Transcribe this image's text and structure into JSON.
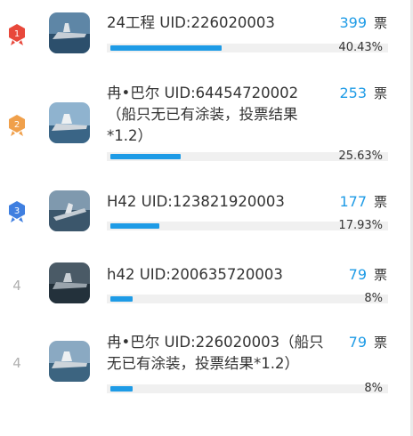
{
  "vote_list": [
    {
      "rank_label": "1",
      "name": "24工程 UID:226020003",
      "votes": "399",
      "unit": "票",
      "percent": "40.43%",
      "fraction": 0.4043
    },
    {
      "rank_label": "2",
      "name": "冉•巴尔 UID:64454720002\n（船只无已有涂装，投票结果\n*1.2）",
      "votes": "253",
      "unit": "票",
      "percent": "25.63%",
      "fraction": 0.2563
    },
    {
      "rank_label": "3",
      "name": "H42 UID:123821920003",
      "votes": "177",
      "unit": "票",
      "percent": "17.93%",
      "fraction": 0.1793
    },
    {
      "rank_label": "4",
      "name": "h42 UID:200635720003",
      "votes": "79",
      "unit": "票",
      "percent": "8%",
      "fraction": 0.08
    },
    {
      "rank_label": "4",
      "name": "冉•巴尔 UID:226020003（船只\n无已有涂装，投票结果*1.2）",
      "votes": "79",
      "unit": "票",
      "percent": "8%",
      "fraction": 0.08
    }
  ],
  "colors": {
    "accent": "#1e9be6",
    "gold": "#e8483b",
    "silver": "#f0a04b",
    "bronze": "#3f7fe0"
  }
}
